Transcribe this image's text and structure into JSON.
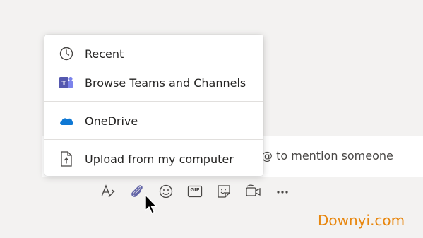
{
  "menu": {
    "items": [
      {
        "label": "Recent",
        "icon": "clock-icon"
      },
      {
        "label": "Browse Teams and Channels",
        "icon": "teams-icon"
      },
      {
        "label": "OneDrive",
        "icon": "onedrive-icon"
      },
      {
        "label": "Upload from my computer",
        "icon": "upload-file-icon"
      }
    ]
  },
  "compose": {
    "hint": "@ to mention someone"
  },
  "toolbar": {
    "icons": [
      "format-icon",
      "attach-icon",
      "emoji-icon",
      "gif-icon",
      "sticker-icon",
      "meet-now-icon",
      "more-options-icon"
    ],
    "gif_label": "GIF"
  },
  "watermark": "Downyi.com",
  "colors": {
    "accent": "#6264a7",
    "onedrive": "#0f78d4",
    "teams": "#5558af",
    "watermark": "#e8870f"
  }
}
